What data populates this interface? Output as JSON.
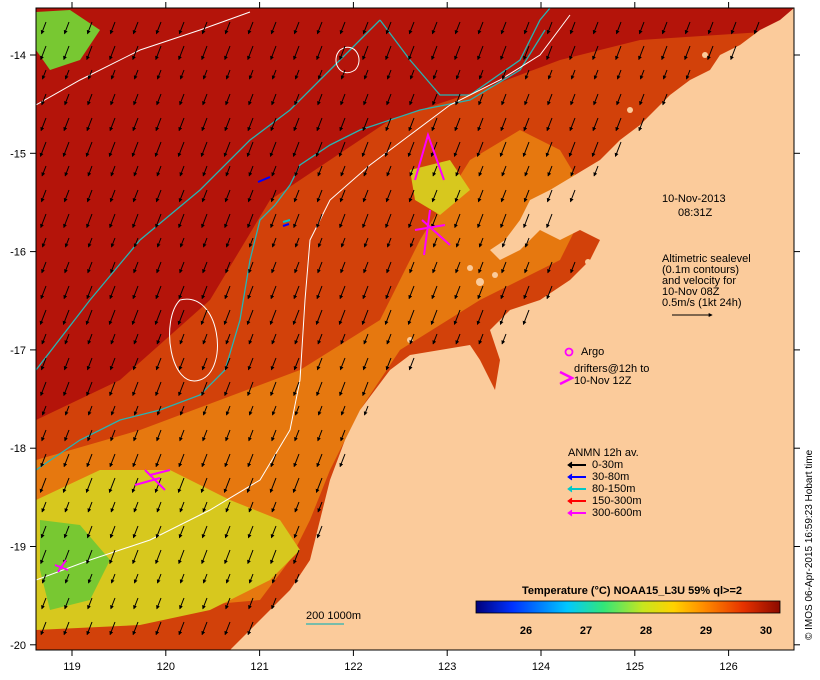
{
  "map": {
    "date": "10-Nov-2013",
    "time": "08:31Z",
    "lon_ticks": [
      "119",
      "120",
      "121",
      "122",
      "123",
      "124",
      "125",
      "126"
    ],
    "lat_ticks": [
      "-14",
      "-15",
      "-16",
      "-17",
      "-18",
      "-19",
      "-20"
    ],
    "altimetry_note": [
      "Altimetric sealevel",
      "(0.1m contours)",
      "and velocity for",
      "10-Nov 08Z",
      "0.5m/s (1kt 24h)"
    ],
    "argo_label": "Argo",
    "drifters_label": [
      "drifters@12h to",
      "10-Nov 12Z"
    ],
    "anmn": {
      "title": "ANMN 12h av.",
      "items": [
        {
          "label": "0-30m",
          "color": "#000000"
        },
        {
          "label": "30-80m",
          "color": "#0000ff"
        },
        {
          "label": "80-150m",
          "color": "#00c8c8"
        },
        {
          "label": "150-300m",
          "color": "#ff0000"
        },
        {
          "label": "300-600m",
          "color": "#ff00ff"
        }
      ]
    },
    "depth_contours_label": "200  1000m",
    "colorbar": {
      "title": "Temperature (°C) NOAA15_L3U 59% ql>=2",
      "ticks": [
        "26",
        "27",
        "28",
        "29",
        "30"
      ]
    },
    "credit": "© IMOS 06-Apr-2015 16:59:23 Hobart time",
    "colors": {
      "land": "#fbcb9b",
      "sea_warm": "#b4140a",
      "sea_mid": "#d2410a",
      "sea_cool": "#e6780f",
      "sea_yellow": "#d7c81e",
      "sea_green": "#78c832",
      "contour_cyan": "#28b4b4",
      "contour_white": "#ffffff",
      "magenta": "#ff00ff"
    }
  }
}
